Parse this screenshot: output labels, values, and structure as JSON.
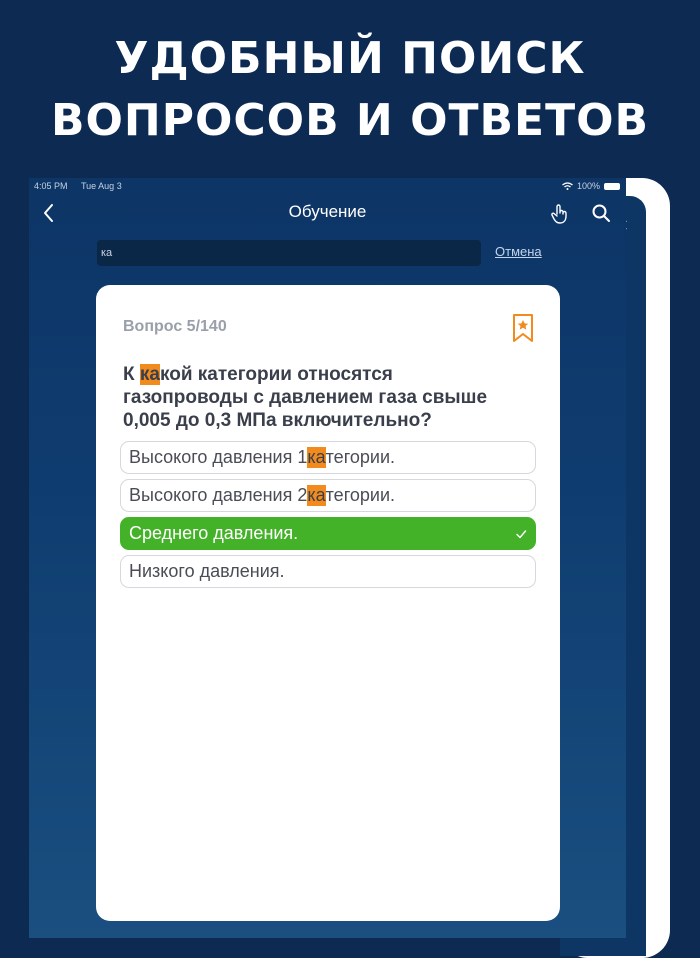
{
  "headline": {
    "line1": "УДОБНЫЙ ПОИСК",
    "line2": "ВОПРОСОВ И ОТВЕТОВ"
  },
  "status_bar": {
    "time": "4:05 PM",
    "date": "Tue Aug 3",
    "battery": "100%"
  },
  "nav": {
    "title": "Обучение"
  },
  "search": {
    "query": "ка",
    "cancel_label": "Отмена"
  },
  "question": {
    "counter": "Вопрос 5/140",
    "text_before": "К ",
    "text_highlight": "ка",
    "text_after": "кой категории относятся газопроводы с давлением газа свыше 0,005 до 0,3 МПа включительно?",
    "answers": [
      {
        "before": "Высокого давления 1 ",
        "highlight": "ка",
        "after": "тегории.",
        "correct": false
      },
      {
        "before": "Высокого давления 2 ",
        "highlight": "ка",
        "after": "тегории.",
        "correct": false
      },
      {
        "before": "Среднего давления.",
        "highlight": "",
        "after": "",
        "correct": true
      },
      {
        "before": "Низкого давления.",
        "highlight": "",
        "after": "",
        "correct": false
      }
    ]
  },
  "colors": {
    "background": "#0c2a52",
    "highlight": "#f28b1e",
    "correct": "#44b229",
    "bookmark": "#f28b1e"
  },
  "icons": {
    "back": "chevron-left-icon",
    "hand": "hand-pointer-icon",
    "search": "search-icon",
    "bookmark": "bookmark-star-icon",
    "check": "checkmark-icon"
  }
}
